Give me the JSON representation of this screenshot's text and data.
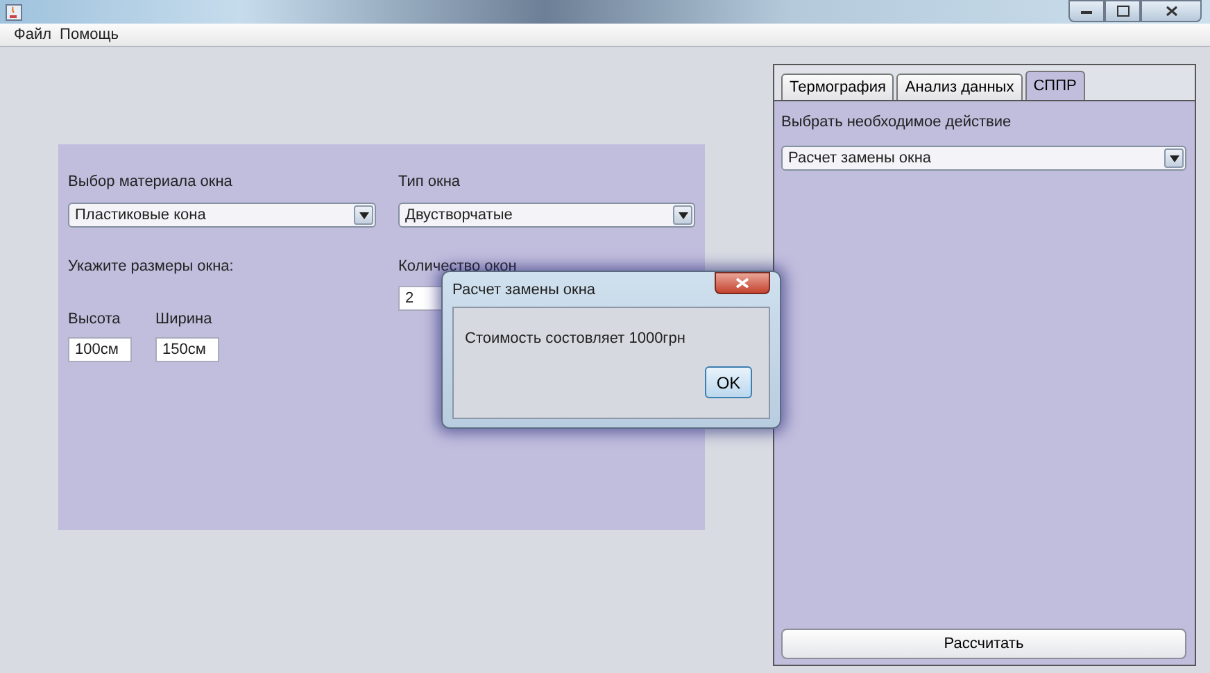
{
  "menu": [
    {
      "label": "Файл"
    },
    {
      "label": "Помощь"
    }
  ],
  "form": {
    "material": {
      "label": "Выбор материала окна",
      "value": "Пластиковые кона"
    },
    "type": {
      "label": "Тип окна",
      "value": "Двустворчатые"
    },
    "size_label": "Укажите размеры окна:",
    "height": {
      "label": "Высота",
      "value": "100см"
    },
    "width": {
      "label": "Ширина",
      "value": "150см"
    },
    "count": {
      "label": "Количество окон",
      "value": "2"
    }
  },
  "tabs": [
    {
      "label": "Термография",
      "selected": false
    },
    {
      "label": "Анализ данных",
      "selected": false
    },
    {
      "label": "СППР",
      "selected": true
    }
  ],
  "action": {
    "label": "Выбрать необходимое действие",
    "value": "Расчет замены окна"
  },
  "calculate_button": "Рассчитать",
  "dialog": {
    "title": "Расчет замены окна",
    "message": "Стоимость состовляет 1000грн",
    "button": "OK"
  }
}
